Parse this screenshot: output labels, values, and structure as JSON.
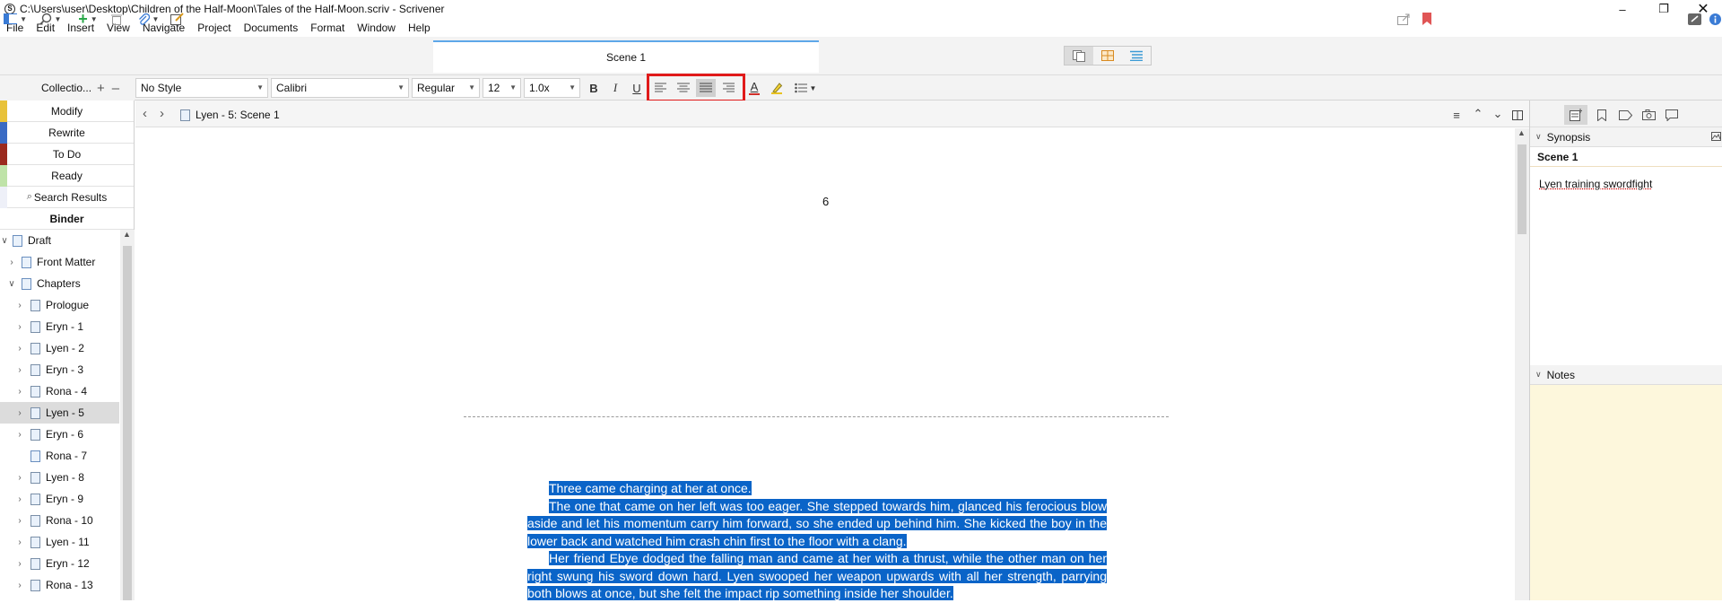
{
  "window": {
    "title": "C:\\Users\\user\\Desktop\\Children of the Half-Moon\\Tales of the Half-Moon.scriv - Scrivener",
    "app_icon_letter": "S"
  },
  "menu": [
    "File",
    "Edit",
    "Insert",
    "View",
    "Navigate",
    "Project",
    "Documents",
    "Format",
    "Window",
    "Help"
  ],
  "toolbar": {
    "document_tab": "Scene 1"
  },
  "collections_header": "Collectio...",
  "format": {
    "style": "No Style",
    "font": "Calibri",
    "weight": "Regular",
    "size": "12",
    "line_spacing": "1.0x",
    "bold": "B",
    "italic": "I",
    "underline": "U",
    "text_color": "A",
    "selected_alignment": "justify"
  },
  "collections": [
    {
      "label": "Modify",
      "color": "#e8c23a"
    },
    {
      "label": "Rewrite",
      "color": "#3a6bc4"
    },
    {
      "label": "To Do",
      "color": "#9b2a1e"
    },
    {
      "label": "Ready",
      "color": "#bfe3a8"
    },
    {
      "label": "Search Results",
      "color": "#f4f4f4"
    },
    {
      "label": "Binder",
      "color": ""
    }
  ],
  "binder": [
    {
      "label": "Draft",
      "level": 0,
      "expanded": true
    },
    {
      "label": "Front Matter",
      "level": 1,
      "expanded": false
    },
    {
      "label": "Chapters",
      "level": 1,
      "expanded": true
    },
    {
      "label": "Prologue",
      "level": 2,
      "expanded": false
    },
    {
      "label": "Eryn - 1",
      "level": 2,
      "expanded": false
    },
    {
      "label": "Lyen - 2",
      "level": 2,
      "expanded": false
    },
    {
      "label": "Eryn - 3",
      "level": 2,
      "expanded": false
    },
    {
      "label": "Rona - 4",
      "level": 2,
      "expanded": false
    },
    {
      "label": "Lyen - 5",
      "level": 2,
      "expanded": false,
      "selected": true
    },
    {
      "label": "Eryn - 6",
      "level": 2,
      "expanded": false
    },
    {
      "label": "Rona - 7",
      "level": 2,
      "expanded": null
    },
    {
      "label": "Lyen - 8",
      "level": 2,
      "expanded": false
    },
    {
      "label": "Eryn - 9",
      "level": 2,
      "expanded": false
    },
    {
      "label": "Rona - 10",
      "level": 2,
      "expanded": false
    },
    {
      "label": "Lyen - 11",
      "level": 2,
      "expanded": false
    },
    {
      "label": "Eryn - 12",
      "level": 2,
      "expanded": false
    },
    {
      "label": "Rona - 13",
      "level": 2,
      "expanded": false
    }
  ],
  "editor": {
    "breadcrumb": "Lyen - 5: Scene 1",
    "page_number": "6",
    "paragraphs": [
      "Three came charging at her at once.",
      "The one that came on her left was too eager. She stepped towards him, glanced his ferocious blow aside and let his momentum carry him forward, so she ended up behind him. She kicked the boy in the lower back and watched him crash chin first to the floor with a clang.",
      "Her friend Ebye dodged the falling man and came at her with a thrust, while the other man on her right swung his sword down hard. Lyen swooped her weapon upwards with all her strength, parrying both blows at once, but she felt the impact rip something inside her shoulder."
    ]
  },
  "inspector": {
    "synopsis_header": "Synopsis",
    "synopsis_title": "Scene 1",
    "synopsis_text": "Lyen training swordfight",
    "notes_header": "Notes"
  },
  "colors": {
    "selection": "#0a64c8",
    "highlight_box": "#e01a1a",
    "notes_bg": "#fdf7dc",
    "bookmark_red": "#e05555",
    "add_green": "#2aa84a"
  }
}
